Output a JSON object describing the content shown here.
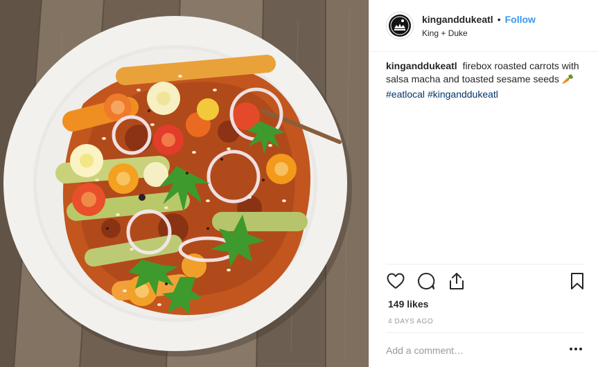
{
  "post": {
    "username": "kinganddukeatl",
    "separator": "•",
    "follow_label": "Follow",
    "location": "King + Duke",
    "caption_text": "firebox roasted carrots with salsa macha and toasted sesame seeds",
    "caption_emoji": "🥕",
    "hashtags": [
      "#eatlocal",
      "#kinganddukeatl"
    ],
    "likes": "149 likes",
    "time_ago": "4 DAYS AGO",
    "comment_placeholder": "Add a comment…"
  },
  "icons": {
    "like": "heart-icon",
    "comment": "comment-bubble-icon",
    "share": "share-upload-icon",
    "save": "bookmark-icon",
    "more": "more-dots-icon"
  },
  "colors": {
    "follow": "#3897f0",
    "hashtag": "#003569",
    "muted": "#999999",
    "text": "#262626"
  }
}
